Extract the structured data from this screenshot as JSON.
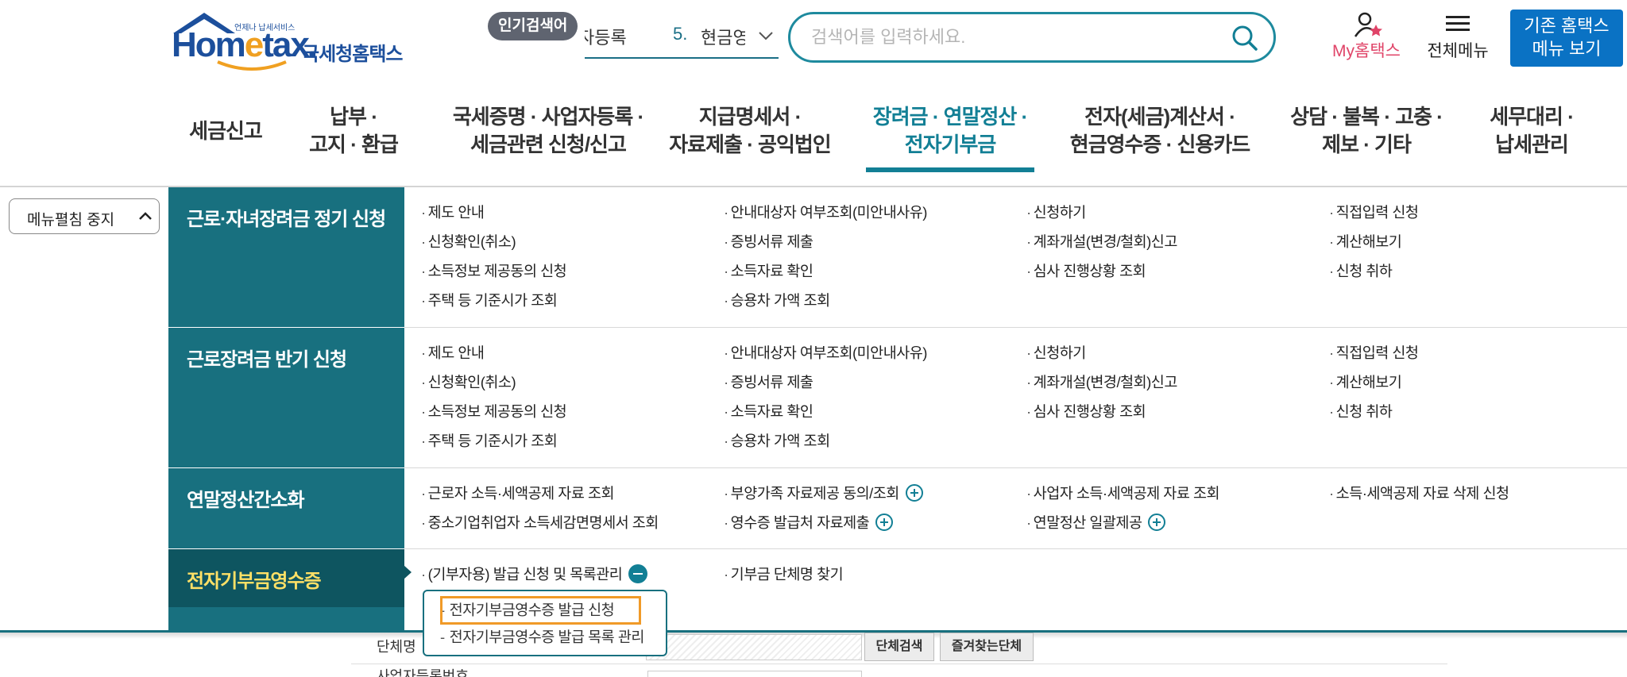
{
  "header": {
    "logo_tagline": "언제나 납세서비스",
    "logo_word": "Hometax",
    "logo_kr": "국세청홈택스",
    "popular_badge": "인기검색어",
    "ticker_prev": "자등록",
    "ticker_num": "5.",
    "ticker_text": "현금영",
    "search_placeholder": "검색어를 입력하세요.",
    "my_hometax": "My홈택스",
    "all_menu": "전체메뉴",
    "old_menu_line1": "기존 홈택스",
    "old_menu_line2": "메뉴 보기"
  },
  "gnb": [
    {
      "l1": "세금신고",
      "l2": ""
    },
    {
      "l1": "납부 ·",
      "l2": "고지 · 환급"
    },
    {
      "l1": "국세증명 · 사업자등록 ·",
      "l2": "세금관련 신청/신고"
    },
    {
      "l1": "지급명세서 ·",
      "l2": "자료제출 · 공익법인"
    },
    {
      "l1": "장려금 · 연말정산 ·",
      "l2": "전자기부금"
    },
    {
      "l1": "전자(세금)계산서 ·",
      "l2": "현금영수증 · 신용카드"
    },
    {
      "l1": "상담 · 불복 · 고충 ·",
      "l2": "제보 · 기타"
    },
    {
      "l1": "세무대리 ·",
      "l2": "납세관리"
    }
  ],
  "collapse_label": "메뉴펼침 중지",
  "sections": [
    {
      "title": "근로·자녀장려금 정기 신청",
      "items": [
        "제도 안내",
        "안내대상자 여부조회(미안내사유)",
        "신청하기",
        "직접입력 신청",
        "신청확인(취소)",
        "증빙서류 제출",
        "계좌개설(변경/철회)신고",
        "계산해보기",
        "소득정보 제공동의 신청",
        "소득자료 확인",
        "심사 진행상황 조회",
        "신청 취하",
        "주택 등 기준시가 조회",
        "승용차 가액 조회"
      ]
    },
    {
      "title": "근로장려금 반기 신청",
      "items": [
        "제도 안내",
        "안내대상자 여부조회(미안내사유)",
        "신청하기",
        "직접입력 신청",
        "신청확인(취소)",
        "증빙서류 제출",
        "계좌개설(변경/철회)신고",
        "계산해보기",
        "소득정보 제공동의 신청",
        "소득자료 확인",
        "심사 진행상황 조회",
        "신청 취하",
        "주택 등 기준시가 조회",
        "승용차 가액 조회"
      ]
    },
    {
      "title": "연말정산간소화",
      "items": [
        "근로자 소득·세액공제 자료 조회",
        "부양가족 자료제공 동의/조회",
        "사업자 소득·세액공제 자료 조회",
        "소득·세액공제 자료 삭제 신청",
        "중소기업취업자 소득세감면명세서 조회",
        "영수증 발급처 자료제출",
        "연말정산 일괄제공"
      ]
    },
    {
      "title": "전자기부금영수증",
      "items": [
        "(기부자용) 발급 신청 및 목록관리",
        "기부금 단체명 찾기"
      ],
      "submenu": [
        "전자기부금영수증 발급 신청",
        "전자기부금영수증 발급 목록 관리"
      ]
    }
  ],
  "under": {
    "org_name_label": "단체명",
    "org_search_btn": "단체검색",
    "fav_org_btn": "즐겨찾는단체",
    "biz_no_label": "사업자등록번호"
  }
}
